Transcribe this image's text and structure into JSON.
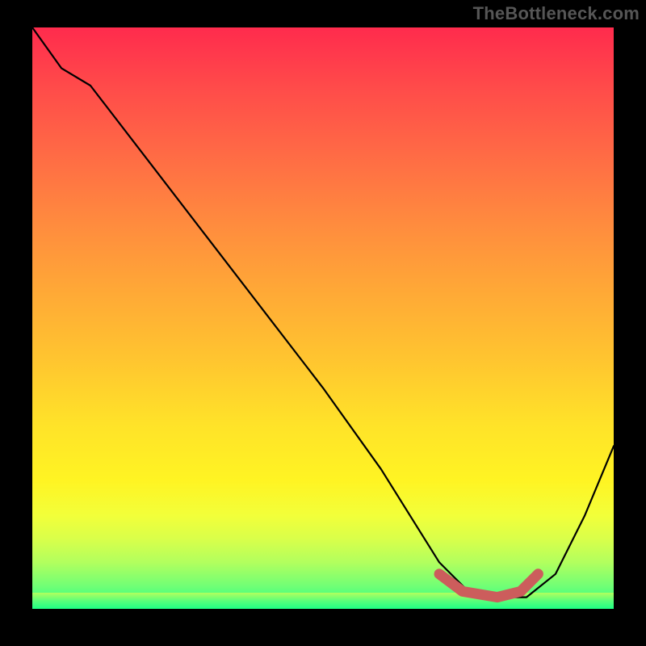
{
  "attribution": "TheBottleneck.com",
  "chart_data": {
    "type": "line",
    "title": "",
    "xlabel": "",
    "ylabel": "",
    "xlim": [
      0,
      100
    ],
    "ylim": [
      0,
      100
    ],
    "series": [
      {
        "name": "bottleneck-curve",
        "x": [
          0,
          5,
          10,
          20,
          30,
          40,
          50,
          60,
          65,
          70,
          75,
          80,
          85,
          90,
          95,
          100
        ],
        "y": [
          100,
          93,
          90,
          77,
          64,
          51,
          38,
          24,
          16,
          8,
          3,
          2,
          2,
          6,
          16,
          28
        ]
      }
    ],
    "highlight_segment": {
      "name": "optimal-range-marker",
      "x": [
        70,
        74,
        80,
        84,
        87
      ],
      "y": [
        6,
        3,
        2,
        3,
        6
      ]
    },
    "gradient_stops": [
      {
        "pos": 0.0,
        "color": "#ff2b4d"
      },
      {
        "pos": 0.22,
        "color": "#ff6b45"
      },
      {
        "pos": 0.46,
        "color": "#ffaa36"
      },
      {
        "pos": 0.68,
        "color": "#ffe229"
      },
      {
        "pos": 0.84,
        "color": "#f2ff3a"
      },
      {
        "pos": 1.0,
        "color": "#22ff88"
      }
    ]
  }
}
